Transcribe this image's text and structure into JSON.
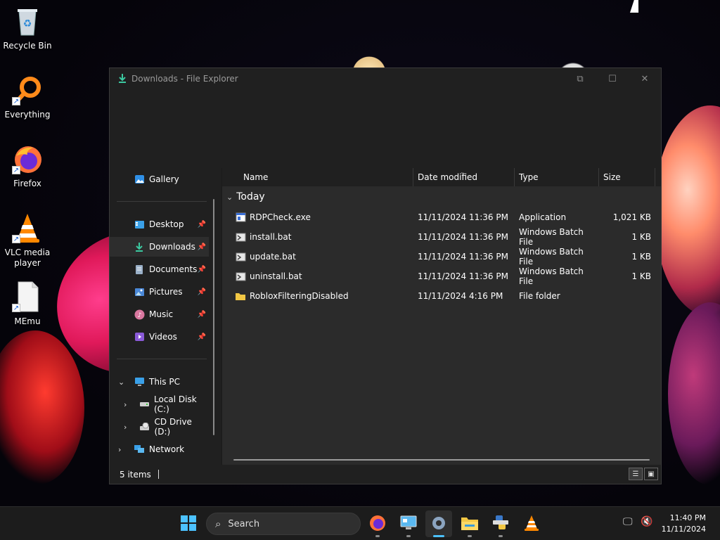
{
  "desktop": {
    "icons": [
      {
        "label": "Recycle Bin",
        "icon": "recycle-bin-icon"
      },
      {
        "label": "Everything",
        "icon": "search-magnifier-icon"
      },
      {
        "label": "Firefox",
        "icon": "firefox-icon"
      },
      {
        "label": "VLC media player",
        "icon": "vlc-cone-icon"
      },
      {
        "label": "MEmu",
        "icon": "blank-document-icon"
      }
    ]
  },
  "window": {
    "title": "Downloads - File Explorer",
    "controls": {
      "minimize": "⧉",
      "maximize": "☐",
      "close": "✕"
    }
  },
  "nav": {
    "items": [
      {
        "label": "Gallery",
        "icon": "gallery-icon"
      },
      {
        "label": "Desktop",
        "icon": "desktop-icon",
        "pinned": "📌"
      },
      {
        "label": "Downloads",
        "icon": "downloads-icon",
        "pinned": "📌"
      },
      {
        "label": "Documents",
        "icon": "documents-icon",
        "pinned": "📌"
      },
      {
        "label": "Pictures",
        "icon": "pictures-icon",
        "pinned": "📌"
      },
      {
        "label": "Music",
        "icon": "music-icon",
        "pinned": "📌"
      },
      {
        "label": "Videos",
        "icon": "videos-icon",
        "pinned": "📌"
      },
      {
        "label": "This PC",
        "icon": "this-pc-icon"
      },
      {
        "label": "Local Disk (C:)",
        "icon": "local-disk-icon"
      },
      {
        "label": "CD Drive (D:)",
        "icon": "cd-drive-icon"
      },
      {
        "label": "Network",
        "icon": "network-icon"
      }
    ],
    "selected": "Downloads"
  },
  "files": {
    "columns": {
      "name": "Name",
      "date": "Date modified",
      "type": "Type",
      "size": "Size"
    },
    "group": "Today",
    "rows": [
      {
        "name": "RDPCheck.exe",
        "date": "11/11/2024 11:36 PM",
        "type": "Application",
        "size": "1,021 KB",
        "icon": "exe-icon"
      },
      {
        "name": "install.bat",
        "date": "11/11/2024 11:36 PM",
        "type": "Windows Batch File",
        "size": "1 KB",
        "icon": "batch-file-icon"
      },
      {
        "name": "update.bat",
        "date": "11/11/2024 11:36 PM",
        "type": "Windows Batch File",
        "size": "1 KB",
        "icon": "batch-file-icon"
      },
      {
        "name": "uninstall.bat",
        "date": "11/11/2024 11:36 PM",
        "type": "Windows Batch File",
        "size": "1 KB",
        "icon": "batch-file-icon"
      },
      {
        "name": "RobloxFilteringDisabled",
        "date": "11/11/2024 4:16 PM",
        "type": "File folder",
        "size": "",
        "icon": "folder-icon"
      }
    ]
  },
  "status": {
    "items": "5 items"
  },
  "taskbar": {
    "search_placeholder": "Search",
    "apps": [
      "start-icon",
      "firefox-icon",
      "control-panel-icon",
      "settings-icon",
      "file-explorer-icon",
      "python-icon",
      "vlc-cone-icon"
    ],
    "active_app": "settings-icon",
    "time": "11:40 PM",
    "date": "11/11/2024"
  },
  "colors": {
    "accent": "#4cc2ff",
    "window_bg": "#202020",
    "pane_bg": "#2b2b2b",
    "folder": "#f2c744"
  }
}
